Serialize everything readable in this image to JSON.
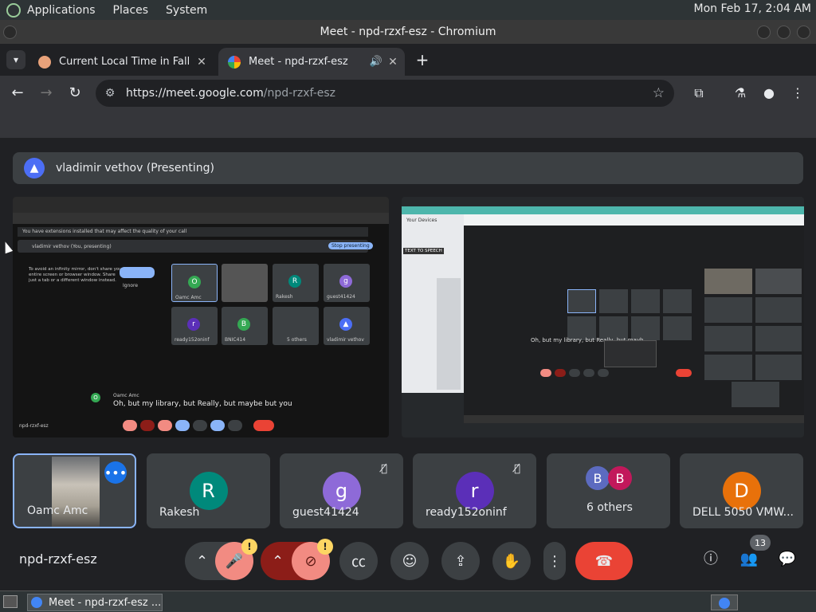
{
  "top_panel": {
    "menus": [
      "Applications",
      "Places",
      "System"
    ],
    "clock": "Mon Feb 17,  2:04 AM"
  },
  "window": {
    "title": "Meet - npd-rzxf-esz - Chromium"
  },
  "tabs": [
    {
      "title": "Current Local Time in Fall Riv",
      "close": "✕"
    },
    {
      "title": "Meet - npd-rzxf-esz",
      "audio": "🔊",
      "close": "✕"
    }
  ],
  "toolbar": {
    "url_host": "https://meet.google.com",
    "url_path": "/npd-rzxf-esz"
  },
  "meet": {
    "presenting_label": "vladimir vethov (Presenting)",
    "left_share": {
      "notice": "You have extensions installed that may affect the quality of your call",
      "presenting": "vladimir vethov (You, presenting)",
      "stop_btn": "Stop presenting",
      "mirror_warning": "To avoid an infinity mirror, don't share your entire screen or browser window. Share just a tab or a different window instead.",
      "ignore": "Ignore",
      "tiles": [
        {
          "name": "Oamc Amc",
          "initial": "O"
        },
        {
          "name": "guest41424",
          "initial": "g"
        },
        {
          "name": "Rakesh",
          "initial": "R"
        },
        {
          "name": "ready152oninf",
          "initial": "r"
        },
        {
          "name": "BNIC414",
          "initial": "B"
        },
        {
          "name": "5 others",
          "initial": ""
        },
        {
          "name": "vladimir vethov",
          "initial": ""
        }
      ],
      "caption_speaker": "Oamc Amc",
      "caption_text": "Oh, but my library, but Really, but maybe but you",
      "code": "npd-rzxf-esz"
    },
    "right_share": {
      "tab1": "Your Devices",
      "badge": "TEXT TO SPEECH",
      "caption_text": "Oh, but my library, but Really, but mayb"
    },
    "tiles": [
      {
        "name": "Oamc Amc",
        "initial": ""
      },
      {
        "name": "Rakesh",
        "initial": "R"
      },
      {
        "name": "guest41424",
        "initial": "g"
      },
      {
        "name": "ready152oninf",
        "initial": "r"
      },
      {
        "name": "6 others",
        "initial": ""
      },
      {
        "name": "DELL 5050 VMW...",
        "initial": "D"
      }
    ],
    "others_initials": [
      "B",
      "B"
    ],
    "meeting_code": "npd-rzxf-esz",
    "participants_count": "13",
    "warn_glyph": "!"
  },
  "taskbar": {
    "item": "Meet - npd-rzxf-esz ..."
  },
  "colors": {
    "accent": "#1a73e8",
    "end_call": "#ea4335",
    "rakesh": "#00897b",
    "guest": "#8e6ad8",
    "ready": "#5b2fb8",
    "dell": "#e8710a",
    "others_b1": "#5c6bc0",
    "others_b2": "#c2185b"
  }
}
